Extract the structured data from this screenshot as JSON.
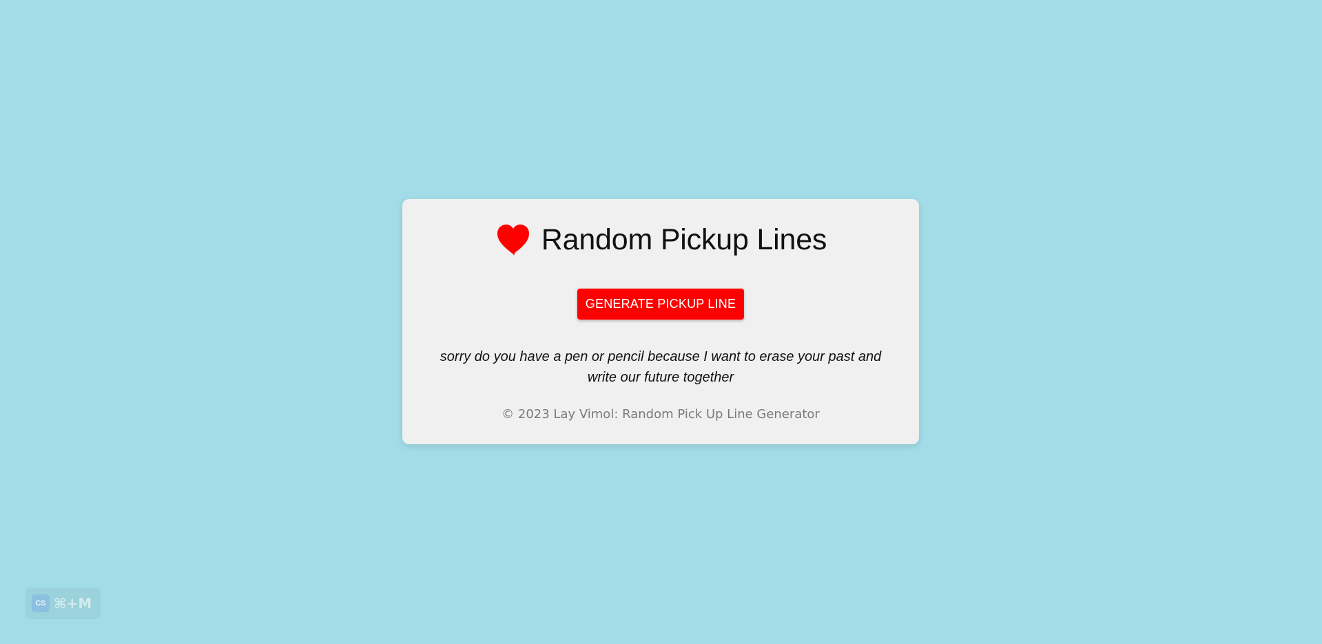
{
  "header": {
    "title": "Random Pickup Lines",
    "icon": "heart-icon"
  },
  "actions": {
    "generate_label": "GENERATE PICKUP LINE"
  },
  "pickup_line": {
    "text": "sorry do you have a pen or pencil because I want to erase your past and write our future together"
  },
  "footer": {
    "text": "© 2023 Lay Vimol: Random Pick Up Line Generator"
  },
  "shortcut": {
    "icon_text": "CS",
    "keys": "⌘+M"
  },
  "colors": {
    "background": "#a2dde7",
    "card": "#f0f0f0",
    "accent": "#ff0000"
  }
}
